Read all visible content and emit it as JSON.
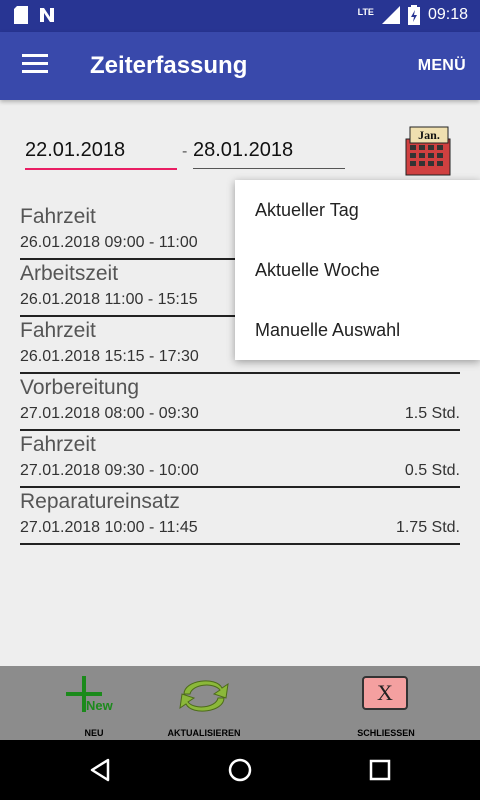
{
  "status": {
    "time": "09:18",
    "network": "LTE"
  },
  "appbar": {
    "title": "Zeiterfassung",
    "menu_label": "MENÜ"
  },
  "dates": {
    "from": "22.01.2018",
    "separator": "-",
    "to": "28.01.2018",
    "calendar_label": "Jan."
  },
  "entries": [
    {
      "name": "Fahrzeit",
      "range": "26.01.2018 09:00 - 11:00",
      "duration": ""
    },
    {
      "name": "Arbeitszeit",
      "range": "26.01.2018 11:00 - 15:15",
      "duration": ""
    },
    {
      "name": "Fahrzeit",
      "range": "26.01.2018 15:15 - 17:30",
      "duration": ""
    },
    {
      "name": "Vorbereitung",
      "range": "27.01.2018 08:00 - 09:30",
      "duration": "1.5 Std."
    },
    {
      "name": "Fahrzeit",
      "range": "27.01.2018 09:30 - 10:00",
      "duration": "0.5 Std."
    },
    {
      "name": "Reparatureinsatz",
      "range": "27.01.2018 10:00 - 11:45",
      "duration": "1.75 Std."
    }
  ],
  "dropdown": {
    "options": [
      "Aktueller Tag",
      "Aktuelle Woche",
      "Manuelle Auswahl"
    ]
  },
  "bottom": {
    "new_label": "NEU",
    "new_icon_text": "New",
    "refresh_label": "AKTUALISIEREN",
    "close_label": "SCHLIESSEN",
    "close_icon_text": "X"
  },
  "colors": {
    "primary": "#3949ab",
    "primary_dark": "#283593",
    "accent": "#e91e63"
  }
}
